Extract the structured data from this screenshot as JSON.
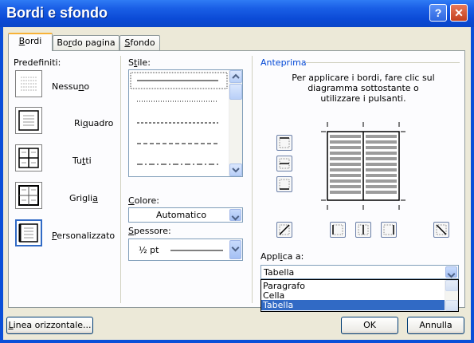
{
  "window": {
    "title": "Bordi e sfondo"
  },
  "titlebar": {
    "help_label": "?",
    "close_label": "✕"
  },
  "tabs": [
    {
      "pre": "",
      "acc": "B",
      "post": "ordi"
    },
    {
      "pre": "Bo",
      "acc": "r",
      "post": "do pagina"
    },
    {
      "pre": "",
      "acc": "S",
      "post": "fondo"
    }
  ],
  "presets": {
    "label": "Predefiniti:",
    "items": [
      {
        "pre": "Nessu",
        "acc": "n",
        "post": "o"
      },
      {
        "pre": "Ri",
        "acc": "q",
        "post": "uadro"
      },
      {
        "pre": "Tu",
        "acc": "t",
        "post": "ti"
      },
      {
        "pre": "Grigli",
        "acc": "a",
        "post": ""
      },
      {
        "pre": "",
        "acc": "P",
        "post": "ersonalizzato"
      }
    ]
  },
  "style": {
    "pre": "S",
    "acc": "t",
    "post": "ile:"
  },
  "color": {
    "acc": "C",
    "post": "olore:",
    "value": "Automatico"
  },
  "width": {
    "acc": "S",
    "post": "pessore:",
    "value": "½ pt"
  },
  "preview": {
    "title": "Anteprima",
    "instructions": [
      "Per applicare i bordi, fare clic sul",
      "diagramma sottostante o",
      "utilizzare i pulsanti."
    ]
  },
  "apply": {
    "pre": "Appl",
    "acc": "i",
    "post": "ca a:",
    "value": "Tabella",
    "options": [
      "Paragrafo",
      "Cella",
      "Tabella"
    ],
    "selected_index": 2
  },
  "footer": {
    "hline": {
      "acc": "L",
      "post": "inea orizzontale..."
    },
    "ok": "OK",
    "cancel": "Annulla"
  },
  "colors": {
    "titlebar": "#0a4fd8",
    "selection": "#316ac5",
    "tab_highlight": "#f7b238"
  }
}
